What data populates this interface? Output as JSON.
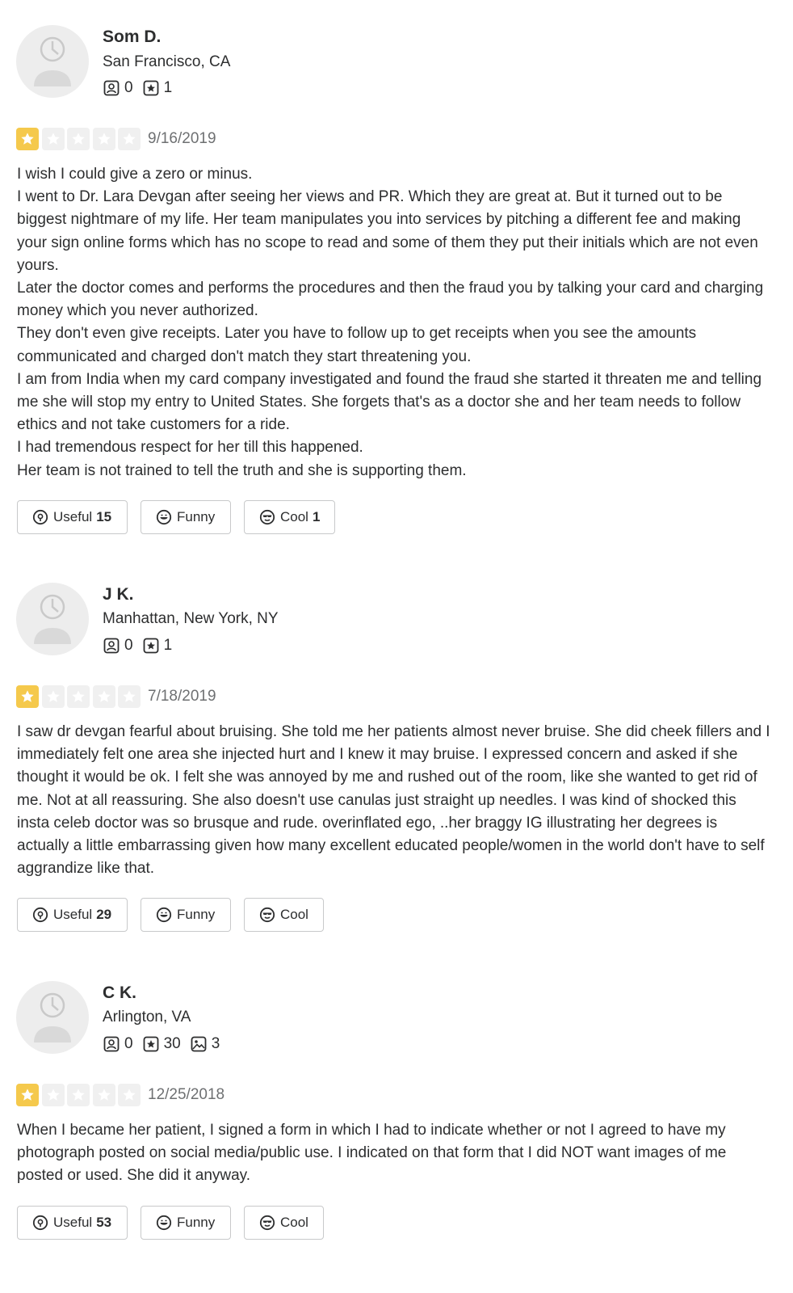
{
  "colors": {
    "star_on": "#f5c94c",
    "star_off": "#f0f0f0",
    "text": "#2d2e2f",
    "muted": "#6e7072",
    "border": "#c8c9ca"
  },
  "reviews": [
    {
      "name": "Som D.",
      "location": "San Francisco, CA",
      "friends": "0",
      "reviews_count": "1",
      "rating": 1,
      "date": "9/16/2019",
      "lines": [
        "I wish I could give a zero or minus.",
        "I went to Dr. Lara Devgan after seeing her views and PR. Which they are great at. But it turned out to be biggest nightmare of my life. Her team manipulates you into services by pitching a different fee and making your sign online forms which has no scope to read and some of them they put their initials which are not even yours.",
        "Later the doctor comes and performs the procedures and then the fraud you by talking your card and charging money which you never authorized.",
        "They don't even give receipts. Later you have to follow up to get receipts when you see the amounts communicated and charged don't match they start threatening you.",
        "I am from India when my card company investigated and found the fraud she started it threaten me and telling me she will stop my entry to United States. She forgets that's as a doctor she and her team needs to follow ethics and not take customers for a ride.",
        "I had tremendous respect for her till this happened.",
        "Her team is not trained to tell the truth and she is supporting them."
      ],
      "useful_label": "Useful",
      "useful_count": "15",
      "funny_label": "Funny",
      "cool_label": "Cool",
      "cool_count": "1"
    },
    {
      "name": "J K.",
      "location": "Manhattan, New York, NY",
      "friends": "0",
      "reviews_count": "1",
      "rating": 1,
      "date": "7/18/2019",
      "lines": [
        "I saw dr devgan fearful about bruising. She told me her patients almost never bruise. She did cheek fillers and I immediately felt one area she injected hurt and I knew it may bruise. I expressed concern and asked if she thought it would be ok. I felt she was annoyed by me and rushed out of the room, like she wanted to get rid of me. Not at all reassuring. She also doesn't use canulas just straight up needles. I was kind of shocked this insta celeb doctor was so brusque and rude. overinflated ego, ..her braggy IG illustrating her degrees is actually a little embarrassing given how many excellent educated people/women in the world don't have to self aggrandize like that."
      ],
      "useful_label": "Useful",
      "useful_count": "29",
      "funny_label": "Funny",
      "cool_label": "Cool",
      "cool_count": ""
    },
    {
      "name": "C K.",
      "location": "Arlington, VA",
      "friends": "0",
      "reviews_count": "30",
      "photos": "3",
      "rating": 1,
      "date": "12/25/2018",
      "lines": [
        "When I became her patient, I signed a form in which I had to indicate whether or not I agreed to have my photograph posted on social media/public use. I indicated on that form that I did NOT want images of me posted or used. She did it anyway."
      ],
      "useful_label": "Useful",
      "useful_count": "53",
      "funny_label": "Funny",
      "cool_label": "Cool",
      "cool_count": ""
    }
  ]
}
